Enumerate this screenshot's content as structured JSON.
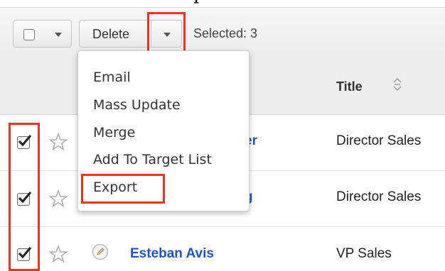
{
  "caption": {
    "text": "p"
  },
  "toolbar": {
    "delete_label": "Delete",
    "selected_text": "Selected: 3"
  },
  "table": {
    "title_header": "Title",
    "rows": [
      {
        "name_fragment": "er",
        "title": "Director Sales",
        "checked": true
      },
      {
        "name_fragment": "g",
        "title": "Director Sales",
        "checked": true
      },
      {
        "name": "Esteban Avis",
        "title": "VP Sales",
        "checked": true
      }
    ]
  },
  "menu": {
    "items": [
      "Email",
      "Mass Update",
      "Merge",
      "Add To Target List",
      "Export"
    ]
  },
  "colors": {
    "highlight": "#ee3322",
    "link": "#2255bb"
  },
  "icons": [
    "checkbox-icon",
    "chevron-down-icon",
    "star-icon",
    "sort-icon",
    "pencil-icon",
    "checkmark-icon"
  ]
}
